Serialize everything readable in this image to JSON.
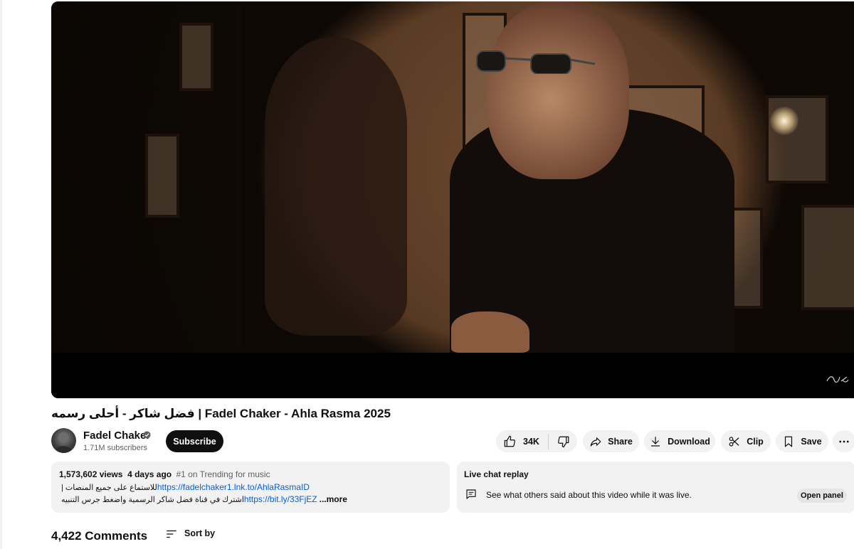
{
  "video": {
    "title": "فضل شاكر - أحلى رسمه | Fadel Chaker - Ahla Rasma 2025"
  },
  "channel": {
    "name": "Fadel Chaker",
    "subscribers": "1.71M subscribers",
    "subscribe_label": "Subscribe"
  },
  "actions": {
    "likes": "34K",
    "share_label": "Share",
    "download_label": "Download",
    "clip_label": "Clip",
    "save_label": "Save"
  },
  "description": {
    "views": "1,573,602 views",
    "age": "4 days ago",
    "trending": "#1 on Trending for music",
    "line1_text": "للاستماع على جميع المنصات |",
    "line1_link": "https://fadelchaker1.lnk.to/AhlaRasmaID",
    "line2_text": "اشترك في قناة فضل شاكر الرسمية واضغط جرس التنبيه",
    "line2_link": "https://bit.ly/33FjEZ",
    "more_label": "...more"
  },
  "live_chat": {
    "title": "Live chat replay",
    "text": "See what others said about this video while it was live.",
    "button_label": "Open panel"
  },
  "comments": {
    "count": "4,422 Comments",
    "sort_label": "Sort by"
  },
  "icons": {
    "like": "thumbs-up-icon",
    "dislike": "thumbs-down-icon",
    "share": "share-arrow-icon",
    "download": "download-icon",
    "clip": "scissors-icon",
    "save": "bookmark-icon",
    "more": "more-horizontal-icon",
    "verified": "verified-check-icon",
    "chat": "chat-bubble-icon",
    "sort": "sort-lines-icon"
  }
}
